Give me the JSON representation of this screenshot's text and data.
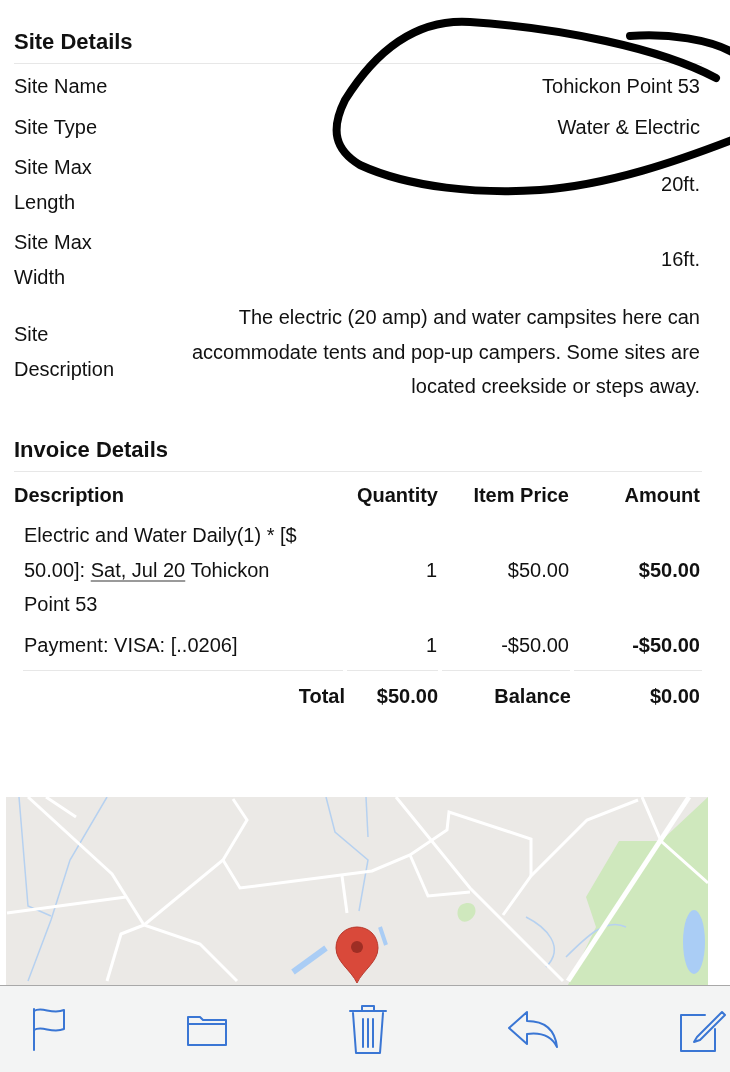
{
  "site_details": {
    "title": "Site Details",
    "rows": [
      {
        "label": "Site Name",
        "value": "Tohickon Point 53"
      },
      {
        "label": "Site Type",
        "value": "Water & Electric"
      },
      {
        "label": "Site Max Length",
        "value": "20ft."
      },
      {
        "label": "Site Max Width",
        "value": "16ft."
      },
      {
        "label": "Site Description",
        "value": "The electric (20 amp) and water campsites here can accommodate tents and pop-up campers. Some sites are located creekside or steps away."
      }
    ]
  },
  "invoice_details": {
    "title": "Invoice Details",
    "columns": [
      "Description",
      "Quantity",
      "Item Price",
      "Amount"
    ],
    "rows": [
      {
        "description": [
          {
            "kind": "text",
            "text": "Electric and Water Daily(1) * [$ 50.00]:"
          },
          {
            "kind": "link",
            "text": "Sat, Jul 20"
          },
          {
            "kind": "text",
            "text": "Tohickon Point 53"
          }
        ],
        "quantity": "1",
        "item_price": "$50.00",
        "amount": "$50.00"
      },
      {
        "description": [
          {
            "kind": "text",
            "text": "Payment: VISA: [..0206]"
          }
        ],
        "quantity": "1",
        "item_price": "-$50.00",
        "amount": "-$50.00"
      }
    ],
    "totals": [
      {
        "label": "Total",
        "value": "$50.00"
      },
      {
        "label": "Balance",
        "value": "$0.00"
      }
    ]
  }
}
